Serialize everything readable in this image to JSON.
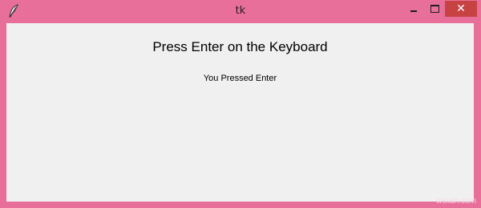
{
  "window": {
    "title": "tk",
    "frame_color": "#e86f9a",
    "client_color": "#f0f0f0",
    "icon": "feather-icon",
    "controls": {
      "minimize_icon": "minimize-icon",
      "maximize_icon": "maximize-icon",
      "close_icon": "close-icon",
      "close_glyph": "✕",
      "close_color": "#c74343"
    }
  },
  "content": {
    "heading": "Press Enter on the Keyboard",
    "message": "You Pressed Enter"
  },
  "watermark": "wsxdn.com"
}
